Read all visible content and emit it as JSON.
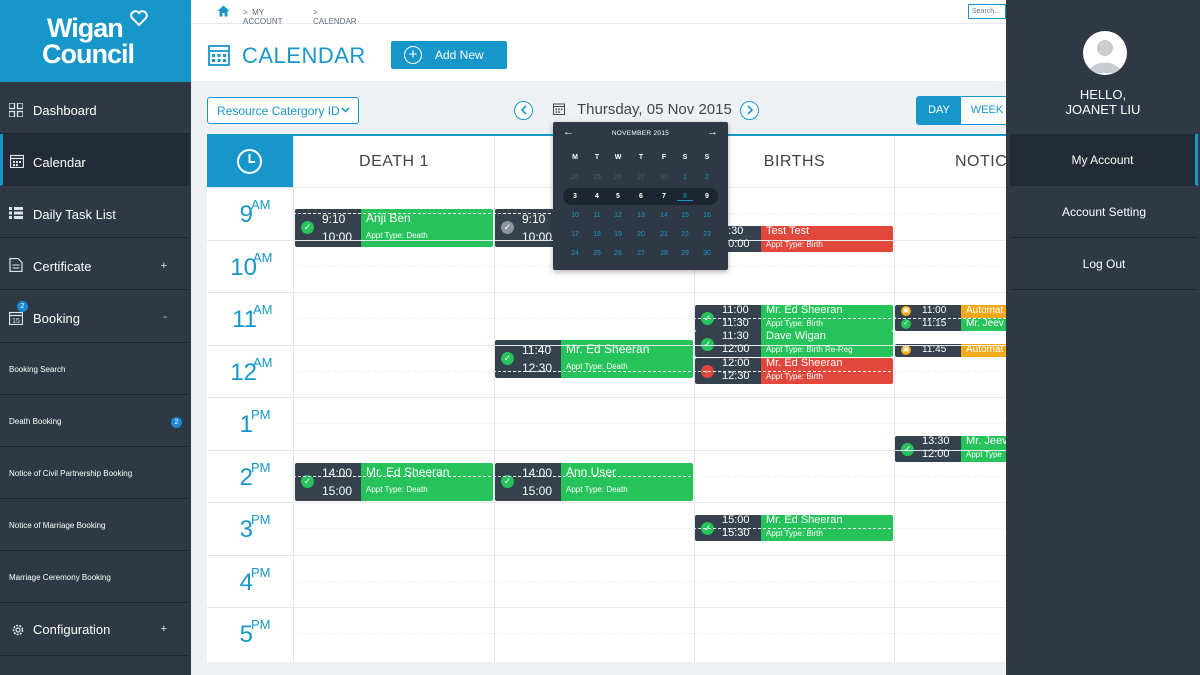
{
  "brand": {
    "line1": "Wigan",
    "line2": "Council"
  },
  "colors": {
    "primary": "#1797c9",
    "sidebar": "#2e3945",
    "green": "#26c35b",
    "red": "#e2473b",
    "orange": "#f3a91a"
  },
  "sidebar": {
    "items": [
      {
        "label": "Dashboard",
        "icon": "grid-icon"
      },
      {
        "label": "Calendar",
        "icon": "calendar-icon",
        "active": true
      },
      {
        "label": "Daily Task List",
        "icon": "list-icon"
      },
      {
        "label": "Certificate",
        "icon": "document-icon",
        "toggle": "+"
      },
      {
        "label": "Booking",
        "icon": "calendar-15-icon",
        "toggle": "-",
        "badge": "2"
      }
    ],
    "subitems": [
      {
        "label": "Booking Search"
      },
      {
        "label": "Death Booking",
        "badge": "2"
      },
      {
        "label": "Notice of Civil Partnership Booking"
      },
      {
        "label": "Notice of Marriage Booking"
      },
      {
        "label": "Marriage Ceremony Booking"
      }
    ],
    "config": {
      "label": "Configuration",
      "icon": "gear-icon",
      "toggle": "+"
    }
  },
  "breadcrumb": {
    "sep": ">",
    "items": [
      "MY ACCOUNT",
      "CALENDAR"
    ]
  },
  "search": {
    "placeholder": "Search..."
  },
  "header": {
    "title": "CALENDAR",
    "add_label": "Add New"
  },
  "toolbar": {
    "resource_select": "Resource Catergory ID",
    "date_label": "Thursday, 05 Nov 2015",
    "view_day": "DAY",
    "view_week": "WEEK"
  },
  "datepicker": {
    "month_label": "NOVEMBER 2015",
    "dow": [
      "M",
      "T",
      "W",
      "T",
      "F",
      "S",
      "S"
    ],
    "weeks": [
      [
        "26",
        "25",
        "26",
        "27",
        "30",
        "1",
        "2"
      ],
      [
        "3",
        "4",
        "5",
        "6",
        "7",
        "8",
        "9"
      ],
      [
        "10",
        "11",
        "12",
        "13",
        "14",
        "15",
        "16"
      ],
      [
        "17",
        "18",
        "19",
        "20",
        "21",
        "22",
        "23"
      ],
      [
        "24",
        "25",
        "26",
        "27",
        "28",
        "29",
        "30"
      ]
    ]
  },
  "columns": [
    "DEATH 1",
    "",
    "BIRTHS",
    "NOTIC"
  ],
  "hours": [
    {
      "n": "9",
      "ap": "AM"
    },
    {
      "n": "10",
      "ap": "AM"
    },
    {
      "n": "11",
      "ap": "AM"
    },
    {
      "n": "12",
      "ap": "AM"
    },
    {
      "n": "1",
      "ap": "PM"
    },
    {
      "n": "2",
      "ap": "PM"
    },
    {
      "n": "3",
      "ap": "PM"
    },
    {
      "n": "4",
      "ap": "PM"
    },
    {
      "n": "5",
      "ap": "PM"
    }
  ],
  "events": [
    {
      "col": 0,
      "start": "9:10",
      "end": "10:00",
      "name": "Anji Ben",
      "type": "Appt Type: Death",
      "color": "green",
      "status": "check"
    },
    {
      "col": 1,
      "start": "9:10",
      "end": "10:00",
      "name": "",
      "type": "",
      "color": "green",
      "status": "grey"
    },
    {
      "col": 2,
      "start": "9:30",
      "end": "10:00",
      "name": "Test  Test",
      "type": "Appt Type: Birth",
      "color": "red",
      "status": "none"
    },
    {
      "col": 2,
      "start": "11:00",
      "end": "11:30",
      "name": "Mr. Ed Sheeran",
      "type": "Appt Type: Birth",
      "color": "green",
      "status": "check"
    },
    {
      "col": 2,
      "start": "11:30",
      "end": "12:00",
      "name": "Dave Wigan",
      "type": "Appt Type: Birth Re-Reg",
      "color": "green",
      "status": "check"
    },
    {
      "col": 2,
      "start": "12:00",
      "end": "12:30",
      "name": "Mr. Ed Sheeran",
      "type": "Appt Type: Birth",
      "color": "red",
      "status": "cancel"
    },
    {
      "col": 3,
      "start": "11:00",
      "end": "",
      "name": "Automat",
      "type": "",
      "color": "orange",
      "status": "lock"
    },
    {
      "col": 3,
      "start": "11:15",
      "end": "11:30",
      "name": "Mr. Jeev",
      "type": "Appt Type",
      "color": "green",
      "status": "check"
    },
    {
      "col": 3,
      "start": "11:45",
      "end": "",
      "name": "Automat",
      "type": "",
      "color": "orange",
      "status": "lock"
    },
    {
      "col": 1,
      "start": "11:40",
      "end": "12:30",
      "name": "Mr. Ed Sheeran",
      "type": "Appt Type: Death",
      "color": "green",
      "status": "check"
    },
    {
      "col": 3,
      "start": "13:30",
      "end": "12:00",
      "name": "Mr. Jeev",
      "type": "Appt Type",
      "color": "green",
      "status": "check"
    },
    {
      "col": 0,
      "start": "14:00",
      "end": "15:00",
      "name": "Mr. Ed Sheeran",
      "type": "Appt Type: Death",
      "color": "green",
      "status": "check"
    },
    {
      "col": 1,
      "start": "14:00",
      "end": "15:00",
      "name": "Ann User",
      "type": "Appt Type: Death",
      "color": "green",
      "status": "check"
    },
    {
      "col": 2,
      "start": "15:00",
      "end": "15:30",
      "name": "Mr. Ed Sheeran",
      "type": "Appt Type: Birth",
      "color": "green",
      "status": "check"
    }
  ],
  "right_panel": {
    "hello": "HELLO,",
    "user": "JOANET LIU",
    "menu": [
      "My Account",
      "Account Setting",
      "Log Out"
    ]
  }
}
